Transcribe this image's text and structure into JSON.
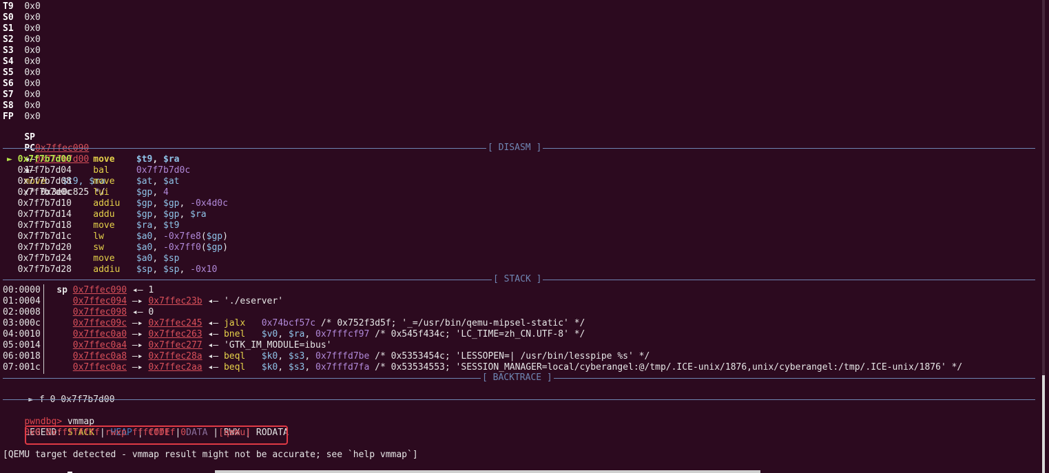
{
  "registers": [
    {
      "name": "T9",
      "value": "0x0"
    },
    {
      "name": "S0",
      "value": "0x0"
    },
    {
      "name": "S1",
      "value": "0x0"
    },
    {
      "name": "S2",
      "value": "0x0"
    },
    {
      "name": "S3",
      "value": "0x0"
    },
    {
      "name": "S4",
      "value": "0x0"
    },
    {
      "name": "S5",
      "value": "0x0"
    },
    {
      "name": "S6",
      "value": "0x0"
    },
    {
      "name": "S7",
      "value": "0x0"
    },
    {
      "name": "S8",
      "value": "0x0"
    },
    {
      "name": "FP",
      "value": "0x0"
    }
  ],
  "sp_reg": {
    "name": "SP",
    "addr": "0x7ffec090",
    "arrow": "◂—",
    "value": "1"
  },
  "pc_reg": {
    "name": "PC",
    "addr": "0x7f7b7d00",
    "arrow": "◂—",
    "mnem": "move",
    "ops": "$t9, $ra",
    "comment": "/* 0x3e0c825 */"
  },
  "sections": {
    "disasm": "[ DISASM ]",
    "stack": "[ STACK ]",
    "backtrace": "[ BACKTRACE ]"
  },
  "disasm": [
    {
      "marker": "►",
      "addr": "0x7f7b7d00",
      "mnem": "move",
      "ops": [
        {
          "t": "reg",
          "v": "$t9"
        },
        {
          "t": "plain",
          "v": ", "
        },
        {
          "t": "reg",
          "v": "$ra"
        }
      ]
    },
    {
      "marker": "",
      "addr": "0x7f7b7d04",
      "mnem": "bal",
      "ops": [
        {
          "t": "imm",
          "v": "0x7f7b7d0c"
        }
      ]
    },
    {
      "marker": "",
      "addr": "0x7f7b7d08",
      "mnem": "move",
      "ops": [
        {
          "t": "reg",
          "v": "$at"
        },
        {
          "t": "plain",
          "v": ", "
        },
        {
          "t": "reg",
          "v": "$at"
        }
      ]
    },
    {
      "marker": "",
      "addr": "0x7f7b7d0c",
      "mnem": "lui",
      "ops": [
        {
          "t": "reg",
          "v": "$gp"
        },
        {
          "t": "plain",
          "v": ", "
        },
        {
          "t": "imm",
          "v": "4"
        }
      ]
    },
    {
      "marker": "",
      "addr": "0x7f7b7d10",
      "mnem": "addiu",
      "ops": [
        {
          "t": "reg",
          "v": "$gp"
        },
        {
          "t": "plain",
          "v": ", "
        },
        {
          "t": "reg",
          "v": "$gp"
        },
        {
          "t": "plain",
          "v": ", "
        },
        {
          "t": "imm",
          "v": "-0x4d0c"
        }
      ]
    },
    {
      "marker": "",
      "addr": "0x7f7b7d14",
      "mnem": "addu",
      "ops": [
        {
          "t": "reg",
          "v": "$gp"
        },
        {
          "t": "plain",
          "v": ", "
        },
        {
          "t": "reg",
          "v": "$gp"
        },
        {
          "t": "plain",
          "v": ", "
        },
        {
          "t": "reg",
          "v": "$ra"
        }
      ]
    },
    {
      "marker": "",
      "addr": "0x7f7b7d18",
      "mnem": "move",
      "ops": [
        {
          "t": "reg",
          "v": "$ra"
        },
        {
          "t": "plain",
          "v": ", "
        },
        {
          "t": "reg",
          "v": "$t9"
        }
      ]
    },
    {
      "marker": "",
      "addr": "0x7f7b7d1c",
      "mnem": "lw",
      "ops": [
        {
          "t": "reg",
          "v": "$a0"
        },
        {
          "t": "plain",
          "v": ", "
        },
        {
          "t": "imm",
          "v": "-0x7fe8"
        },
        {
          "t": "plain",
          "v": "("
        },
        {
          "t": "reg",
          "v": "$gp"
        },
        {
          "t": "plain",
          "v": ")"
        }
      ]
    },
    {
      "marker": "",
      "addr": "0x7f7b7d20",
      "mnem": "sw",
      "ops": [
        {
          "t": "reg",
          "v": "$a0"
        },
        {
          "t": "plain",
          "v": ", "
        },
        {
          "t": "imm",
          "v": "-0x7ff0"
        },
        {
          "t": "plain",
          "v": "("
        },
        {
          "t": "reg",
          "v": "$gp"
        },
        {
          "t": "plain",
          "v": ")"
        }
      ]
    },
    {
      "marker": "",
      "addr": "0x7f7b7d24",
      "mnem": "move",
      "ops": [
        {
          "t": "reg",
          "v": "$a0"
        },
        {
          "t": "plain",
          "v": ", "
        },
        {
          "t": "reg",
          "v": "$sp"
        }
      ]
    },
    {
      "marker": "",
      "addr": "0x7f7b7d28",
      "mnem": "addiu",
      "ops": [
        {
          "t": "reg",
          "v": "$sp"
        },
        {
          "t": "plain",
          "v": ", "
        },
        {
          "t": "reg",
          "v": "$sp"
        },
        {
          "t": "plain",
          "v": ", "
        },
        {
          "t": "imm",
          "v": "-0x10"
        }
      ]
    }
  ],
  "stack": [
    {
      "offset": "00:0000",
      "tag": "sp",
      "addr": "0x7ffec090",
      "rest": [
        {
          "t": "plain",
          "v": " ◂— 1"
        }
      ]
    },
    {
      "offset": "01:0004",
      "tag": "",
      "addr": "0x7ffec094",
      "rest": [
        {
          "t": "plain",
          "v": " —▸ "
        },
        {
          "t": "addr",
          "v": "0x7ffec23b"
        },
        {
          "t": "plain",
          "v": " ◂— './eserver'"
        }
      ]
    },
    {
      "offset": "02:0008",
      "tag": "",
      "addr": "0x7ffec098",
      "rest": [
        {
          "t": "plain",
          "v": " ◂— 0"
        }
      ]
    },
    {
      "offset": "03:000c",
      "tag": "",
      "addr": "0x7ffec09c",
      "rest": [
        {
          "t": "plain",
          "v": " —▸ "
        },
        {
          "t": "addr",
          "v": "0x7ffec245"
        },
        {
          "t": "plain",
          "v": " ◂— "
        },
        {
          "t": "mnem",
          "v": "jalx"
        },
        {
          "t": "plain",
          "v": "   "
        },
        {
          "t": "imm",
          "v": "0x74bcf57c"
        },
        {
          "t": "plain",
          "v": " /* 0x752f3d5f; '_=/usr/bin/qemu-mipsel-static' */"
        }
      ]
    },
    {
      "offset": "04:0010",
      "tag": "",
      "addr": "0x7ffec0a0",
      "rest": [
        {
          "t": "plain",
          "v": " —▸ "
        },
        {
          "t": "addr",
          "v": "0x7ffec263"
        },
        {
          "t": "plain",
          "v": " ◂— "
        },
        {
          "t": "mnem",
          "v": "bnel"
        },
        {
          "t": "plain",
          "v": "   "
        },
        {
          "t": "reg",
          "v": "$v0"
        },
        {
          "t": "plain",
          "v": ", "
        },
        {
          "t": "reg",
          "v": "$ra"
        },
        {
          "t": "plain",
          "v": ", "
        },
        {
          "t": "imm",
          "v": "0x7fffcf97"
        },
        {
          "t": "plain",
          "v": " /* 0x545f434c; 'LC_TIME=zh_CN.UTF-8' */"
        }
      ]
    },
    {
      "offset": "05:0014",
      "tag": "",
      "addr": "0x7ffec0a4",
      "rest": [
        {
          "t": "plain",
          "v": " —▸ "
        },
        {
          "t": "addr",
          "v": "0x7ffec277"
        },
        {
          "t": "plain",
          "v": " ◂— 'GTK_IM_MODULE=ibus'"
        }
      ]
    },
    {
      "offset": "06:0018",
      "tag": "",
      "addr": "0x7ffec0a8",
      "rest": [
        {
          "t": "plain",
          "v": " —▸ "
        },
        {
          "t": "addr",
          "v": "0x7ffec28a"
        },
        {
          "t": "plain",
          "v": " ◂— "
        },
        {
          "t": "mnem",
          "v": "beql"
        },
        {
          "t": "plain",
          "v": "   "
        },
        {
          "t": "reg",
          "v": "$k0"
        },
        {
          "t": "plain",
          "v": ", "
        },
        {
          "t": "reg",
          "v": "$s3"
        },
        {
          "t": "plain",
          "v": ", "
        },
        {
          "t": "imm",
          "v": "0x7fffd7be"
        },
        {
          "t": "plain",
          "v": " /* 0x5353454c; 'LESSOPEN=| /usr/bin/lesspipe %s' */"
        }
      ]
    },
    {
      "offset": "07:001c",
      "tag": "",
      "addr": "0x7ffec0ac",
      "rest": [
        {
          "t": "plain",
          "v": " —▸ "
        },
        {
          "t": "addr",
          "v": "0x7ffec2aa"
        },
        {
          "t": "plain",
          "v": " ◂— "
        },
        {
          "t": "mnem",
          "v": "beql"
        },
        {
          "t": "plain",
          "v": "   "
        },
        {
          "t": "reg",
          "v": "$k0"
        },
        {
          "t": "plain",
          "v": ", "
        },
        {
          "t": "reg",
          "v": "$s3"
        },
        {
          "t": "plain",
          "v": ", "
        },
        {
          "t": "imm",
          "v": "0x7fffd7fa"
        },
        {
          "t": "plain",
          "v": " /* 0x53534553; 'SESSION_MANAGER=local/cyberangel:@/tmp/.ICE-unix/1876,unix/cyberangel:/tmp/.ICE-unix/1876' */"
        }
      ]
    }
  ],
  "backtrace": {
    "marker": "►",
    "text": " f 0 0x7f7b7d00"
  },
  "prompt": "pwndbg>",
  "command": " vmmap",
  "legend": {
    "label": "LEGEND: ",
    "stack": "STACK",
    "heap": "HEAP",
    "code": "CODE",
    "data": "DATA",
    "rwx": "RWX",
    "rodata": "RODATA",
    "sep": " | "
  },
  "vmmap_row": "    0x0 0xffffffff rwxp ffffffff 0      [qemu]",
  "warning": "[QEMU target detected - vmmap result might not be accurate; see `help vmmap`]",
  "colors": {
    "background": "#2c0a1f",
    "prompt": "#e0464e",
    "section": "#6f86b3",
    "highlight_box": "#e03a45"
  }
}
